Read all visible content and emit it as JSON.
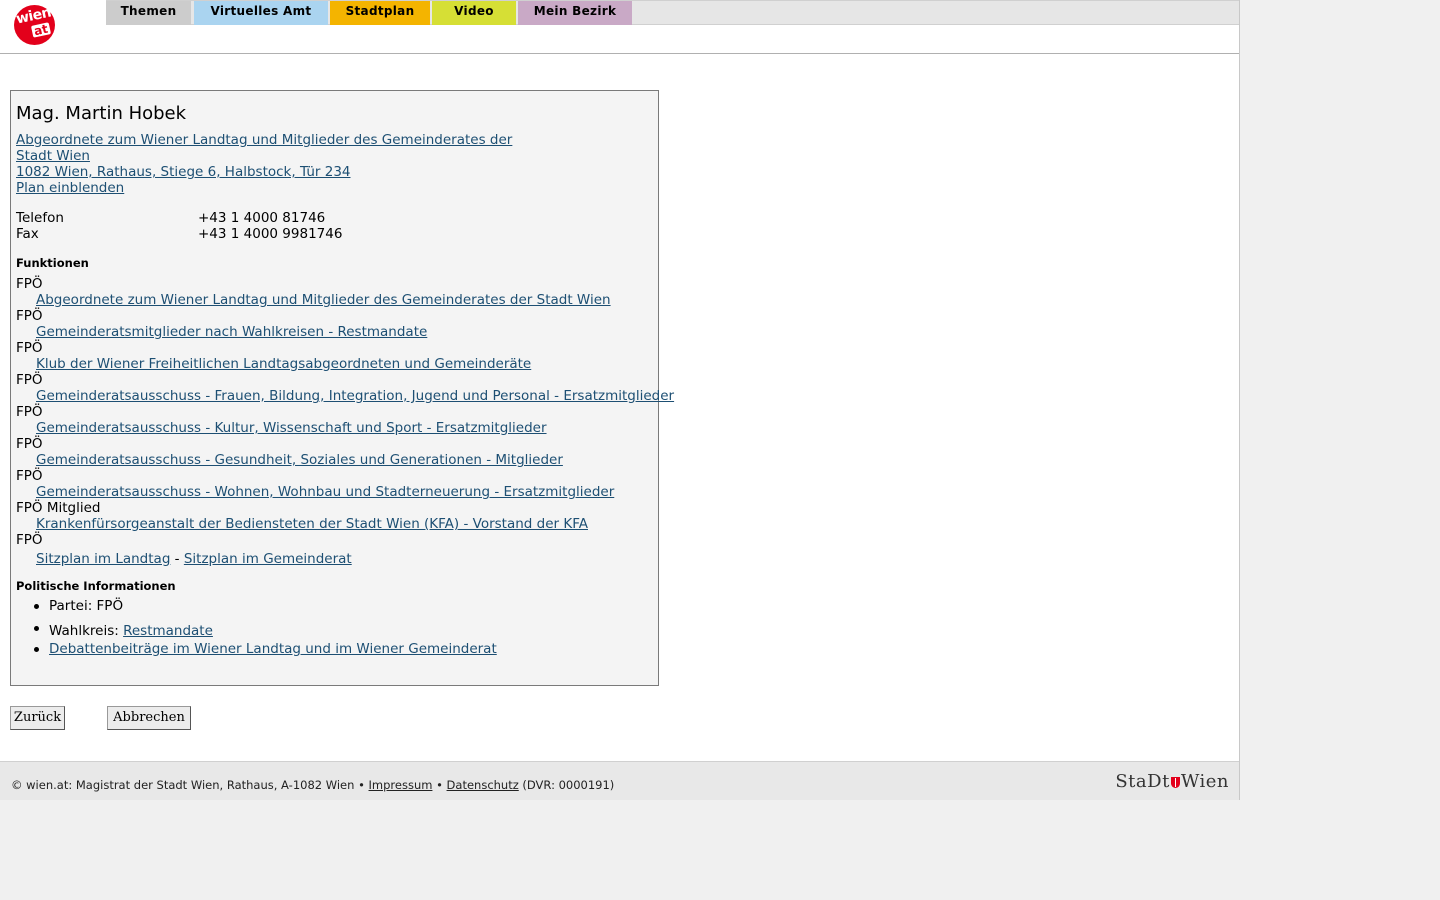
{
  "header": {
    "logo": {
      "line1": "wien",
      "line2": "at"
    },
    "tabs": [
      {
        "label": "Themen",
        "color": "#cccccc"
      },
      {
        "label": "Virtuelles Amt",
        "color": "#aad4f0"
      },
      {
        "label": "Stadtplan",
        "color": "#f4b400"
      },
      {
        "label": "Video",
        "color": "#d6df35"
      },
      {
        "label": "Mein Bezirk",
        "color": "#c9a9c6"
      }
    ]
  },
  "person": {
    "name": "Mag. Martin Hobek",
    "org_line1": "Abgeordnete zum Wiener Landtag und Mitglieder des Gemeinderates der",
    "org_line2": "Stadt Wien",
    "address": "1082 Wien, Rathaus, Stiege 6, Halbstock, Tür 234",
    "map_link": "Plan einblenden",
    "phone_label": "Telefon",
    "phone": "+43 1 4000 81746",
    "fax_label": "Fax",
    "fax": "+43 1 4000 9981746"
  },
  "functions": {
    "heading": "Funktionen",
    "items": [
      {
        "party": "FPÖ",
        "link": "Abgeordnete zum Wiener Landtag und Mitglieder des Gemeinderates der Stadt Wien"
      },
      {
        "party": "FPÖ",
        "link": "Gemeinderatsmitglieder nach Wahlkreisen - Restmandate"
      },
      {
        "party": "FPÖ",
        "link": "Klub der Wiener Freiheitlichen Landtagsabgeordneten und Gemeinderäte"
      },
      {
        "party": "FPÖ",
        "link": "Gemeinderatsausschuss - Frauen, Bildung, Integration, Jugend und Personal - Ersatzmitglieder"
      },
      {
        "party": "FPÖ",
        "link": "Gemeinderatsausschuss - Kultur, Wissenschaft und Sport - Ersatzmitglieder"
      },
      {
        "party": "FPÖ",
        "link": "Gemeinderatsausschuss - Gesundheit, Soziales und Generationen - Mitglieder"
      },
      {
        "party": "FPÖ",
        "link": "Gemeinderatsausschuss - Wohnen, Wohnbau und Stadterneuerung - Ersatzmitglieder"
      },
      {
        "party": "FPÖ Mitglied",
        "link": "Krankenfürsorgeanstalt der Bediensteten der Stadt Wien (KFA) - Vorstand der KFA"
      }
    ],
    "last_party": "FPÖ",
    "seat_landtag": "Sitzplan im Landtag",
    "seat_sep": " - ",
    "seat_gemeinderat": "Sitzplan im Gemeinderat"
  },
  "political": {
    "heading": "Politische Informationen",
    "party_label": "Partei: FPÖ",
    "district_label": "Wahlkreis: ",
    "district_link": "Restmandate",
    "debates_link": "Debattenbeiträge im Wiener Landtag und im Wiener Gemeinderat"
  },
  "buttons": {
    "back": "Zurück",
    "cancel": "Abbrechen"
  },
  "footer": {
    "copyright": "© wien.at: Magistrat der Stadt Wien, Rathaus, A-1082 Wien •",
    "impressum": "Impressum",
    "bullet": "•",
    "datenschutz": "Datenschutz",
    "dvr": "(DVR: 0000191)",
    "brand_left": "StaDt",
    "brand_right": "Wien"
  }
}
